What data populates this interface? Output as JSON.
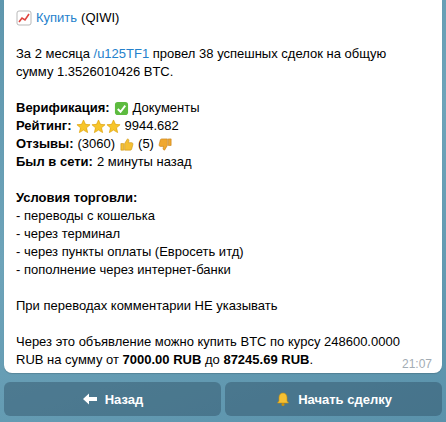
{
  "message": {
    "title": {
      "link": "Купить",
      "text": "(QIWI)"
    },
    "summary": [
      [
        {
          "text": "За 2 месяца ",
          "kind": "plain"
        },
        {
          "text": "/u125TF1",
          "kind": "link"
        },
        {
          "text": " провел 38 успешных сделок на общую",
          "kind": "plain"
        }
      ],
      [
        {
          "text": "сумму 1.3526010426 BTC.",
          "kind": "plain"
        }
      ]
    ],
    "fields": [
      {
        "kind": "verified",
        "label": "Верификация:",
        "value": "Документы"
      },
      {
        "kind": "rating",
        "label": "Рейтинг:",
        "value": "9944.682",
        "stars": 3
      },
      {
        "kind": "reviews",
        "label": "Отзывы:",
        "positive": "(3060)",
        "negative": "(5)"
      },
      {
        "kind": "plain",
        "label": "Был в сети:",
        "value": "2 минуты назад"
      }
    ],
    "conditions": {
      "title": "Условия торговли:",
      "items": [
        "- переводы с кошелька",
        "- через терминал",
        "- через пункты оплаты (Евросеть итд)",
        "- пополнение через интернет-банки"
      ]
    },
    "note": "При переводах комментарии НЕ указывать",
    "offer": [
      [
        {
          "text": "Через это объявление можно купить BTC по курсу 248600.0000",
          "kind": "plain"
        }
      ],
      [
        {
          "text": "RUB на сумму от ",
          "kind": "plain"
        },
        {
          "text": "7000.00 RUB",
          "kind": "bold"
        },
        {
          "text": " до ",
          "kind": "plain"
        },
        {
          "text": "87245.69 RUB",
          "kind": "bold"
        },
        {
          "text": ".",
          "kind": "plain"
        }
      ]
    ],
    "time": "21:07"
  },
  "buttons": [
    {
      "label": "Назад"
    },
    {
      "label": "Начать сделку"
    }
  ]
}
